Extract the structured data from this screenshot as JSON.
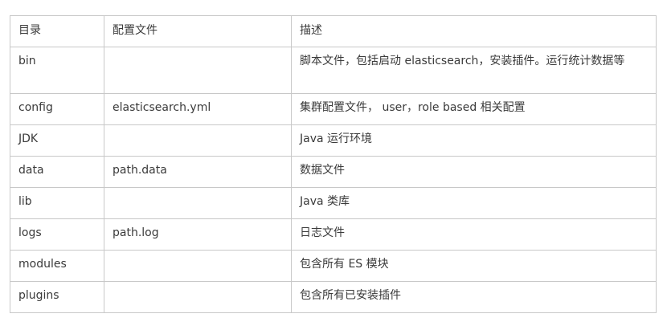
{
  "table": {
    "headers": [
      "目录",
      "配置文件",
      "描述"
    ],
    "rows": [
      {
        "dir": "bin",
        "config": "",
        "desc": "脚本文件，包括启动 elasticsearch，安装插件。运行统计数据等"
      },
      {
        "dir": "config",
        "config": "elasticsearch.yml",
        "desc": "集群配置文件， user，role based 相关配置"
      },
      {
        "dir": "JDK",
        "config": "",
        "desc": "Java 运行环境"
      },
      {
        "dir": "data",
        "config": "path.data",
        "desc": "数据文件"
      },
      {
        "dir": "lib",
        "config": "",
        "desc": "Java 类库"
      },
      {
        "dir": "logs",
        "config": "path.log",
        "desc": "日志文件"
      },
      {
        "dir": "modules",
        "config": "",
        "desc": "包含所有 ES 模块"
      },
      {
        "dir": "plugins",
        "config": "",
        "desc": "包含所有已安装插件"
      }
    ]
  }
}
